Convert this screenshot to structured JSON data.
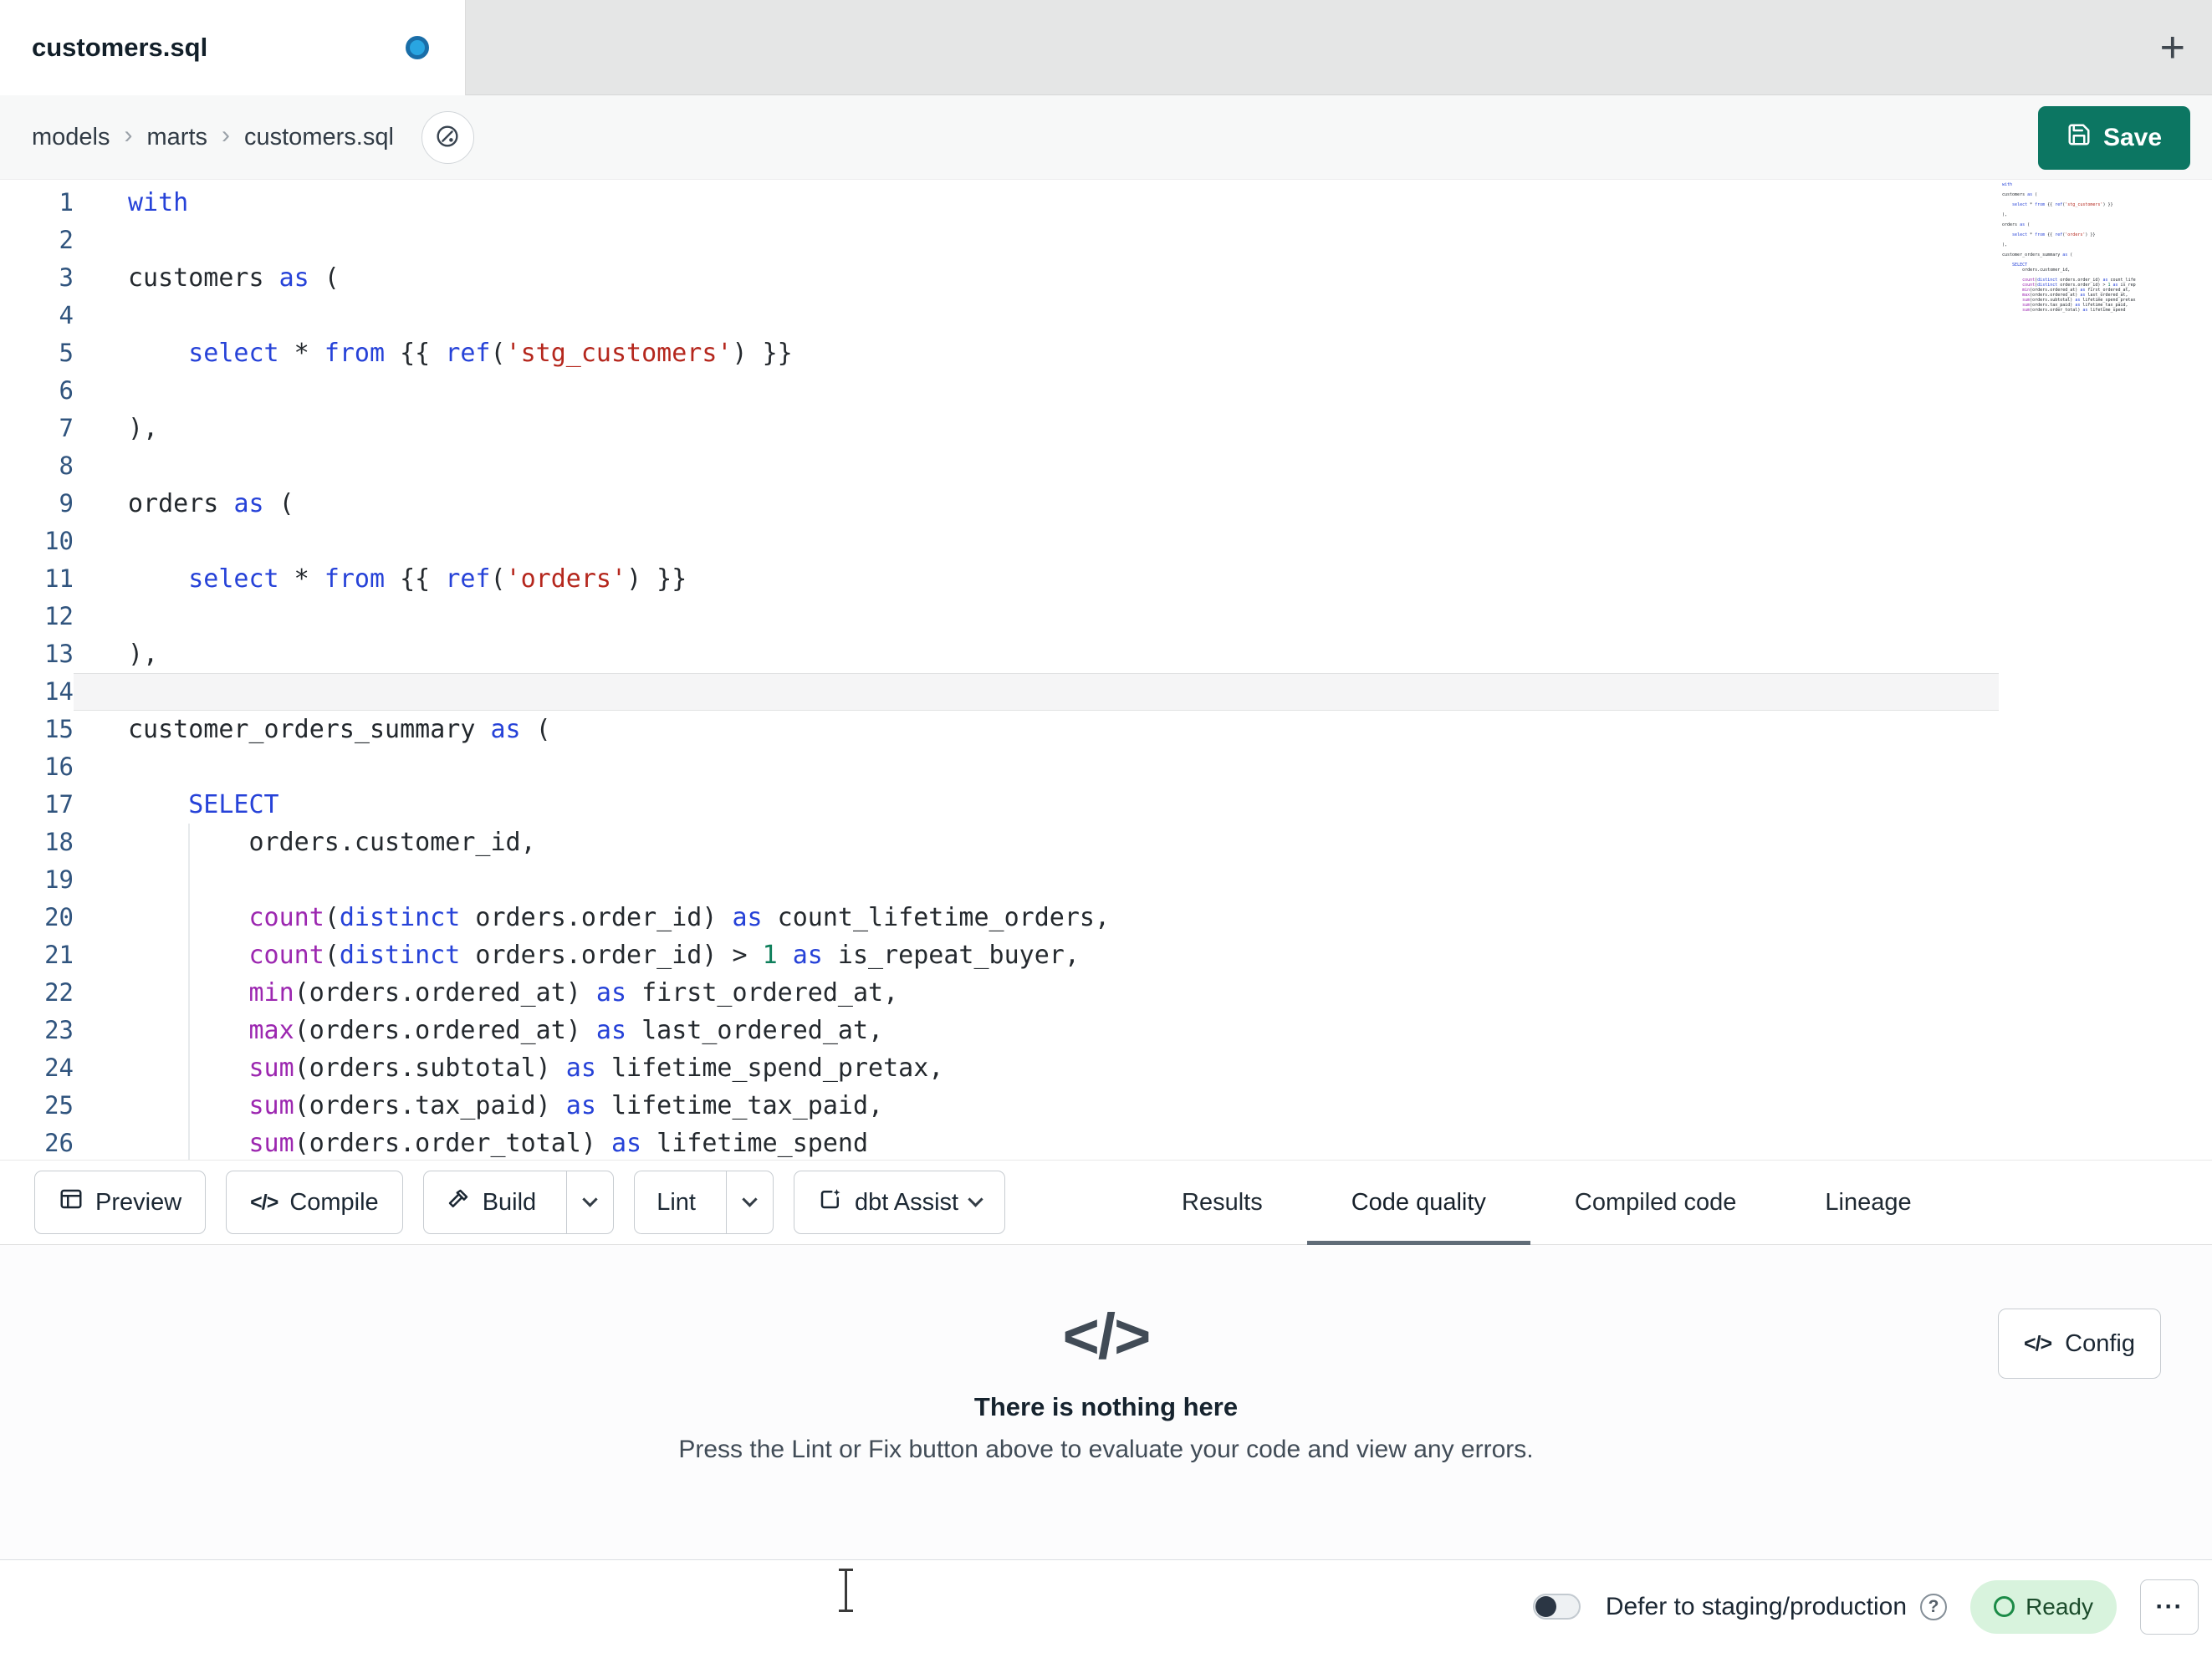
{
  "tab_bar": {
    "active_tab": "customers.sql",
    "new_tab_glyph": "+"
  },
  "breadcrumb": {
    "items": [
      "models",
      "marts",
      "customers.sql"
    ],
    "separator": "›"
  },
  "save": {
    "label": "Save"
  },
  "editor": {
    "language": "sql",
    "active_line_number": 14,
    "lines": [
      [
        [
          "kw",
          "with"
        ]
      ],
      [],
      [
        [
          "pl",
          "customers "
        ],
        [
          "kw",
          "as"
        ],
        [
          "pl",
          " ("
        ]
      ],
      [],
      [
        [
          "pl",
          "    "
        ],
        [
          "kw",
          "select"
        ],
        [
          "pl",
          " * "
        ],
        [
          "kw",
          "from"
        ],
        [
          "pl",
          " {{ "
        ],
        [
          "kw",
          "ref"
        ],
        [
          "pl",
          "("
        ],
        [
          "str",
          "'stg_customers'"
        ],
        [
          "pl",
          ") }}"
        ]
      ],
      [],
      [
        [
          "pl",
          "),"
        ]
      ],
      [],
      [
        [
          "pl",
          "orders "
        ],
        [
          "kw",
          "as"
        ],
        [
          "pl",
          " ("
        ]
      ],
      [],
      [
        [
          "pl",
          "    "
        ],
        [
          "kw",
          "select"
        ],
        [
          "pl",
          " * "
        ],
        [
          "kw",
          "from"
        ],
        [
          "pl",
          " {{ "
        ],
        [
          "kw",
          "ref"
        ],
        [
          "pl",
          "("
        ],
        [
          "str",
          "'orders'"
        ],
        [
          "pl",
          ") }}"
        ]
      ],
      [],
      [
        [
          "pl",
          "),"
        ]
      ],
      [],
      [
        [
          "pl",
          "customer_orders_summary "
        ],
        [
          "kw",
          "as"
        ],
        [
          "pl",
          " ("
        ]
      ],
      [],
      [
        [
          "pl",
          "    "
        ],
        [
          "kw",
          "SELECT"
        ]
      ],
      [
        [
          "pl",
          "        orders.customer_id,"
        ]
      ],
      [],
      [
        [
          "pl",
          "        "
        ],
        [
          "fn",
          "count"
        ],
        [
          "pl",
          "("
        ],
        [
          "kw",
          "distinct"
        ],
        [
          "pl",
          " orders.order_id) "
        ],
        [
          "kw",
          "as"
        ],
        [
          "pl",
          " count_lifetime_orders,"
        ]
      ],
      [
        [
          "pl",
          "        "
        ],
        [
          "fn",
          "count"
        ],
        [
          "pl",
          "("
        ],
        [
          "kw",
          "distinct"
        ],
        [
          "pl",
          " orders.order_id) > "
        ],
        [
          "num",
          "1"
        ],
        [
          "pl",
          " "
        ],
        [
          "kw",
          "as"
        ],
        [
          "pl",
          " is_repeat_buyer,"
        ]
      ],
      [
        [
          "pl",
          "        "
        ],
        [
          "fn",
          "min"
        ],
        [
          "pl",
          "(orders.ordered_at) "
        ],
        [
          "kw",
          "as"
        ],
        [
          "pl",
          " first_ordered_at,"
        ]
      ],
      [
        [
          "pl",
          "        "
        ],
        [
          "fn",
          "max"
        ],
        [
          "pl",
          "(orders.ordered_at) "
        ],
        [
          "kw",
          "as"
        ],
        [
          "pl",
          " last_ordered_at,"
        ]
      ],
      [
        [
          "pl",
          "        "
        ],
        [
          "fn",
          "sum"
        ],
        [
          "pl",
          "(orders.subtotal) "
        ],
        [
          "kw",
          "as"
        ],
        [
          "pl",
          " lifetime_spend_pretax,"
        ]
      ],
      [
        [
          "pl",
          "        "
        ],
        [
          "fn",
          "sum"
        ],
        [
          "pl",
          "(orders.tax_paid) "
        ],
        [
          "kw",
          "as"
        ],
        [
          "pl",
          " lifetime_tax_paid,"
        ]
      ],
      [
        [
          "pl",
          "        "
        ],
        [
          "fn",
          "sum"
        ],
        [
          "pl",
          "(orders.order_total) "
        ],
        [
          "kw",
          "as"
        ],
        [
          "pl",
          " lifetime_spend"
        ]
      ]
    ]
  },
  "toolbar": {
    "preview_label": "Preview",
    "compile_label": "Compile",
    "build_label": "Build",
    "lint_label": "Lint",
    "assist_label": "dbt Assist",
    "code_glyph": "</>"
  },
  "result_tabs": [
    {
      "label": "Results",
      "active": false
    },
    {
      "label": "Code quality",
      "active": true
    },
    {
      "label": "Compiled code",
      "active": false
    },
    {
      "label": "Lineage",
      "active": false
    }
  ],
  "panel": {
    "icon_glyph": "</>",
    "title": "There is nothing here",
    "subtitle": "Press the Lint or Fix button above to evaluate your code and view any errors.",
    "config_label": "Config"
  },
  "status_bar": {
    "defer_label": "Defer to staging/production",
    "help_glyph": "?",
    "ready_label": "Ready",
    "more_glyph": "···"
  },
  "colors": {
    "save_button": "#0c7662",
    "keyword_blue": "#2642d8",
    "function_purple": "#9c27b0",
    "string_red": "#b5271d",
    "number_green": "#0e7f5b",
    "unsaved_dot_blue": "#29a5e1",
    "ready_badge_bg": "#d8f3dd",
    "ready_badge_green": "#1c8b47"
  }
}
